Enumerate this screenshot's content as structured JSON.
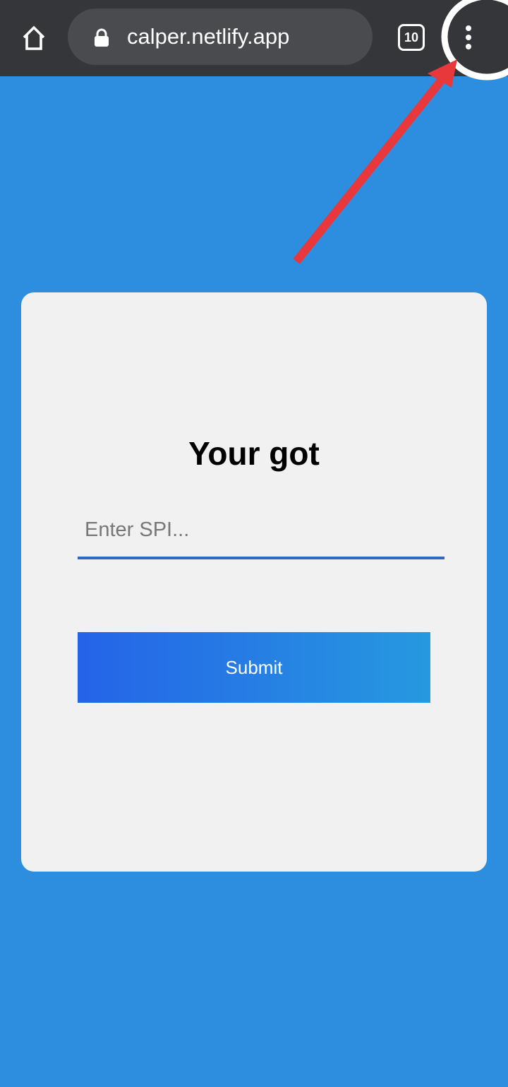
{
  "browser": {
    "url": "calper.netlify.app",
    "tab_count": "10",
    "icons": {
      "home": "home-icon",
      "lock": "lock-icon",
      "menu": "more-vert-icon"
    },
    "colors": {
      "toolbar": "#35363a",
      "url_bar": "#4a4b4f"
    }
  },
  "page": {
    "background": "#2d8ee0",
    "card": {
      "title": "Your got",
      "input_placeholder": "Enter SPI...",
      "input_value": "",
      "submit_label": "Submit"
    },
    "colors": {
      "card_bg": "#f1f1f1",
      "input_underline": "#3268c0",
      "button_gradient_start": "#2563e8",
      "button_gradient_end": "#2699df"
    }
  },
  "annotation": {
    "type": "arrow-and-circle",
    "target": "browser-menu-button",
    "arrow_color": "#e8383b",
    "circle_color": "#ffffff"
  }
}
